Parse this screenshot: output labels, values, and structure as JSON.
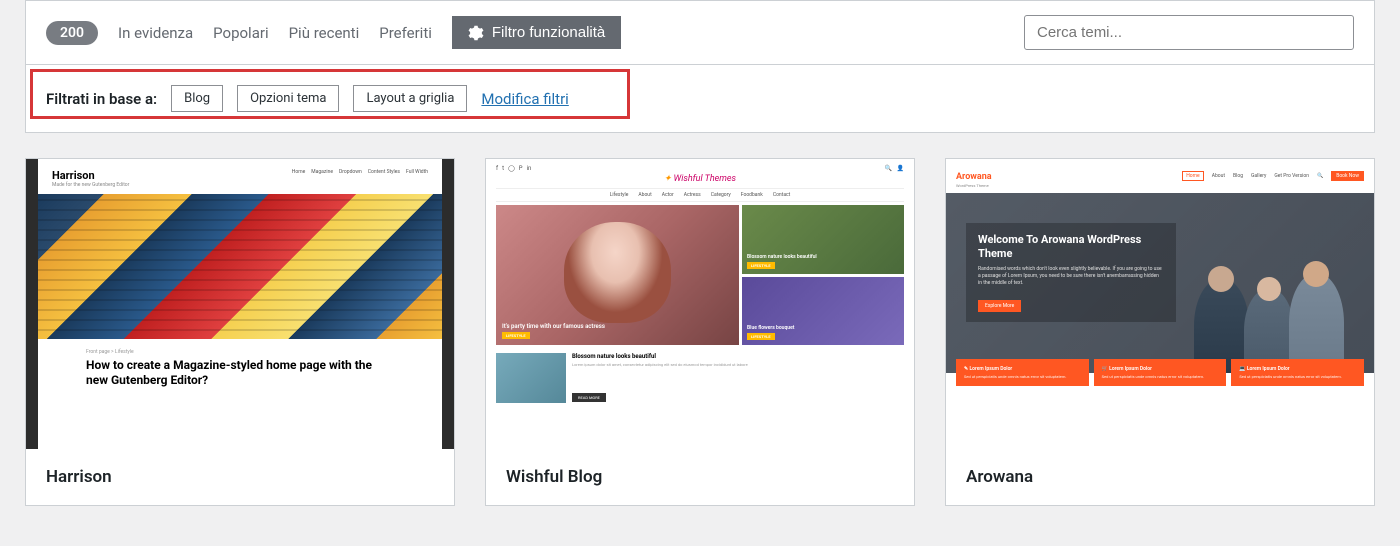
{
  "toolbar": {
    "count": "200",
    "nav": [
      "In evidenza",
      "Popolari",
      "Più recenti",
      "Preferiti"
    ],
    "feature_filter": "Filtro funzionalità",
    "search_placeholder": "Cerca temi..."
  },
  "filters": {
    "label": "Filtrati in base a:",
    "tags": [
      "Blog",
      "Opzioni tema",
      "Layout a griglia"
    ],
    "modify": "Modifica filtri"
  },
  "themes": [
    {
      "name": "Harrison",
      "preview": {
        "logo": "Harrison",
        "tagline": "Made for the new Gutenberg Editor",
        "nav": [
          "Home",
          "Magazine",
          "Dropdown",
          "Content Styles",
          "Full Width"
        ],
        "crumb": "Front page > Lifestyle",
        "title": "How to create a Magazine-styled home page with the new Gutenberg Editor?"
      }
    },
    {
      "name": "Wishful Blog",
      "preview": {
        "logo": "Wishful Themes",
        "nav": [
          "Lifestyle",
          "About",
          "Actor",
          "Actress",
          "Category",
          "Foodbank",
          "Contact"
        ],
        "main_title": "It's party time with our famous actress",
        "side1_title": "Blossom nature looks beautiful",
        "side2_title": "Blue flowers bouquet",
        "btn_label": "LIFESTYLE",
        "post_title": "Blossom nature looks beautiful",
        "post_text": "Lorem ipsum dolor sit amet, consectetur adipiscing elit sed do eiusmod tempor incididunt ut labore",
        "post_btn": "READ MORE"
      }
    },
    {
      "name": "Arowana",
      "preview": {
        "logo": "Arowana",
        "logo_sub": "WordPress Theme",
        "nav": [
          "Home",
          "About",
          "Blog",
          "Gallery",
          "Get Pro Version"
        ],
        "book": "Book Now",
        "hero_title": "Welcome To Arowana WordPress Theme",
        "hero_text": "Randomised words which don't look even slightly believable. If you are going to use a passage of Lorem Ipsum, you need to be sure there isn't anembarrassing hidden in the middle of text.",
        "cta": "Explore More",
        "box_title": "Lorem Ipsum Dolor",
        "box_text": "Sed ut perspiciatis unde omnis natus error sit voluptatem."
      }
    }
  ]
}
